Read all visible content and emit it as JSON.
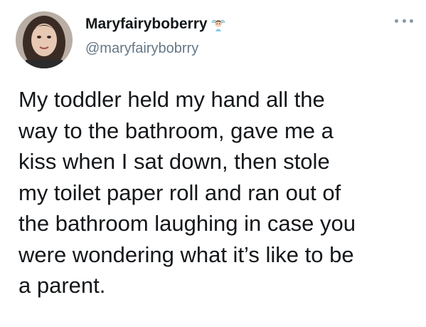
{
  "tweet": {
    "author": {
      "display_name": "Maryfairyboberry",
      "name_emoji": "fairy-emoji",
      "handle": "@maryfairybobrry"
    },
    "menu_icon": "more-horizontal-icon",
    "text_lines": [
      "My toddler held my hand all the",
      "way to the bathroom, gave me a",
      "kiss when I sat down, then stole",
      "my toilet paper roll and ran out of",
      "the bathroom laughing in case you",
      "were wondering what it’s like to be",
      "a parent."
    ]
  },
  "colors": {
    "text": "#14171a",
    "secondary_text": "#657786",
    "menu_dots": "#8899a6",
    "background": "#ffffff"
  }
}
